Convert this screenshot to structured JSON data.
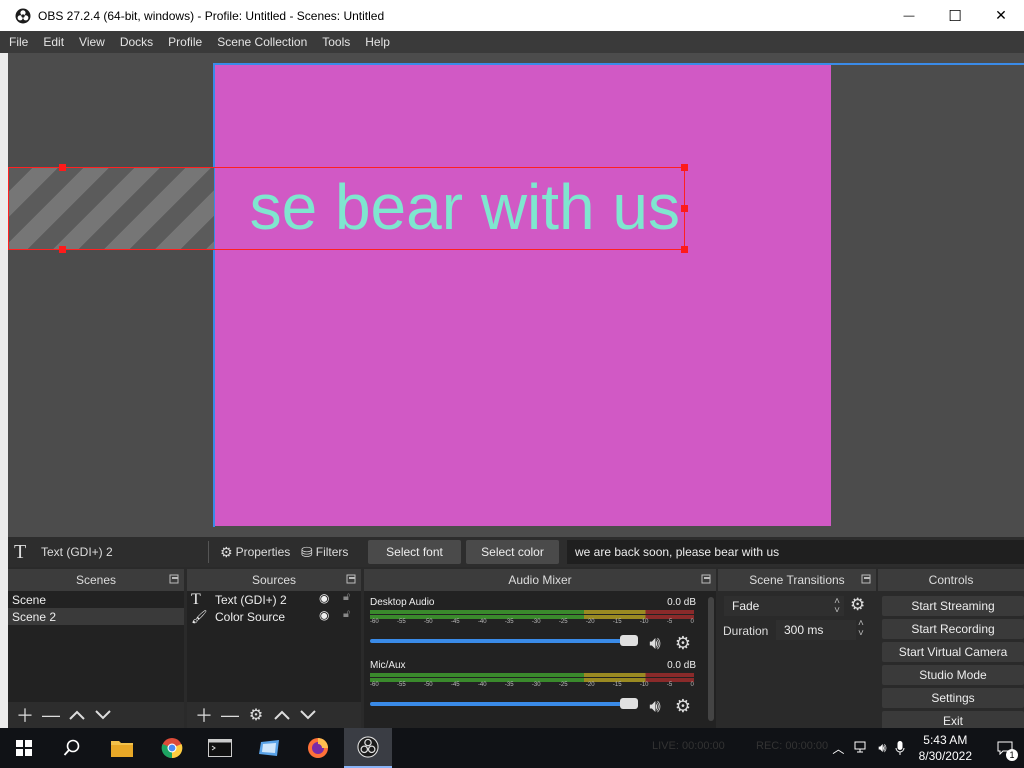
{
  "window": {
    "title": "OBS 27.2.4 (64-bit, windows) - Profile: Untitled - Scenes: Untitled",
    "minimize_glyph": "—",
    "maximize_glyph": "☐",
    "close_glyph": "✕"
  },
  "menu": [
    "File",
    "Edit",
    "View",
    "Docks",
    "Profile",
    "Scene Collection",
    "Tools",
    "Help"
  ],
  "preview": {
    "canvas_color": "#d159c5",
    "text": "se bear with us",
    "text_color": "#7fe6cf",
    "selection_color": "#ff2020"
  },
  "source_toolbar": {
    "source_name": "Text (GDI+) 2",
    "properties_label": "Properties",
    "filters_label": "Filters",
    "select_font_label": "Select font",
    "select_color_label": "Select color",
    "text_value": "we are back soon, please bear with us"
  },
  "scenes": {
    "title": "Scenes",
    "items": [
      "Scene",
      "Scene 2"
    ],
    "selected_index": 1
  },
  "sources": {
    "title": "Sources",
    "items": [
      {
        "name": "Text (GDI+) 2",
        "icon": "text-icon"
      },
      {
        "name": "Color Source",
        "icon": "brush-icon"
      }
    ]
  },
  "audio_mixer": {
    "title": "Audio Mixer",
    "scale": [
      "-60",
      "-55",
      "-50",
      "-45",
      "-40",
      "-35",
      "-30",
      "-25",
      "-20",
      "-15",
      "-10",
      "-5",
      "0"
    ],
    "channels": [
      {
        "name": "Desktop Audio",
        "db": "0.0 dB",
        "volume": 1.0
      },
      {
        "name": "Mic/Aux",
        "db": "0.0 dB",
        "volume": 1.0
      }
    ]
  },
  "scene_transitions": {
    "title": "Scene Transitions",
    "transition": "Fade",
    "duration_label": "Duration",
    "duration_value": "300 ms"
  },
  "controls": {
    "title": "Controls",
    "buttons": [
      "Start Streaming",
      "Start Recording",
      "Start Virtual Camera",
      "Studio Mode",
      "Settings",
      "Exit"
    ]
  },
  "status": {
    "live": "LIVE: 00:00:00",
    "rec": "REC: 00:00:00"
  },
  "taskbar": {
    "time": "5:43 AM",
    "date": "8/30/2022",
    "notification_count": "1"
  }
}
